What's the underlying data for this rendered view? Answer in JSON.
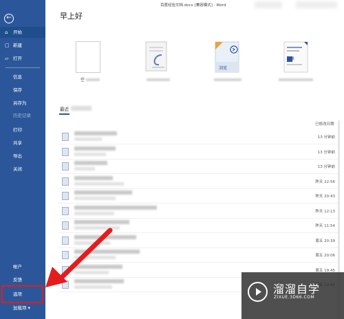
{
  "window": {
    "title": "百度经验文档.docx [兼容模式] - Word"
  },
  "sidebar": {
    "back_icon": "←",
    "top_items": [
      {
        "label": "开始",
        "icon": "⌂"
      },
      {
        "label": "新建",
        "icon": "▢"
      },
      {
        "label": "打开",
        "icon": "▱"
      }
    ],
    "items": [
      {
        "label": "信息"
      },
      {
        "label": "保存"
      },
      {
        "label": "另存为"
      },
      {
        "label": "历史记录"
      },
      {
        "label": "打印"
      },
      {
        "label": "共享"
      },
      {
        "label": "导出"
      },
      {
        "label": "关闭"
      }
    ],
    "bottom_items": [
      {
        "label": "帐户"
      },
      {
        "label": "反馈"
      },
      {
        "label": "选项"
      },
      {
        "label": "加载项 ▾"
      }
    ],
    "bg_color": "#2b579a",
    "highlight_color": "#e51c1c"
  },
  "main": {
    "greeting": "早上好",
    "templates": [
      {
        "caption": "空"
      },
      {
        "caption": ""
      },
      {
        "caption": "浏览"
      },
      {
        "caption": "目录"
      }
    ],
    "recent_tab": "最近",
    "modified_header": "已修改日期",
    "recent_times": [
      "13 分钟前",
      "13 分钟前",
      "13 分钟前",
      "昨天 22:56",
      "昨天 20:43",
      "昨天 12:13",
      "昨天 11:54",
      "周五 20:39",
      "周五 20:06",
      "周五 19:45",
      "周五 19:42"
    ]
  },
  "watermark": {
    "title": "溜溜自学",
    "subtitle": "ZIXUE.3D66.COM"
  }
}
